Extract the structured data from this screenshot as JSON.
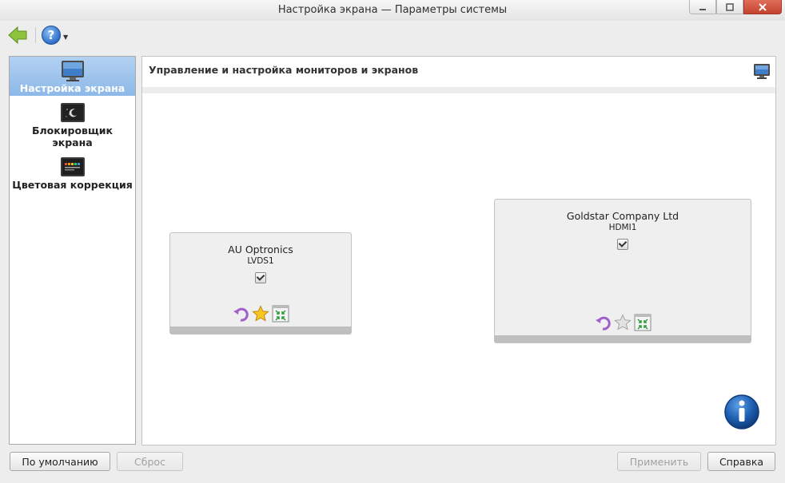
{
  "window": {
    "title": "Настройка экрана — Параметры системы",
    "controls": [
      "minimize",
      "maximize",
      "close"
    ]
  },
  "toolbar": {
    "back_icon": "back-arrow-icon",
    "help_icon": "help-icon"
  },
  "sidebar": {
    "items": [
      {
        "label": "Настройка экрана",
        "icon": "monitor-icon",
        "selected": true
      },
      {
        "label": "Блокировщик экрана",
        "icon": "screen-locker-icon",
        "selected": false
      },
      {
        "label": "Цветовая коррекция",
        "icon": "color-correction-icon",
        "selected": false
      }
    ]
  },
  "panel": {
    "header_title": "Управление и настройка мониторов и экранов",
    "header_icon": "monitor-icon"
  },
  "monitors": [
    {
      "name": "AU Optronics",
      "port": "LVDS1",
      "enabled": true,
      "primary": true
    },
    {
      "name": "Goldstar Company Ltd",
      "port": "HDMI1",
      "enabled": true,
      "primary": false
    }
  ],
  "buttons": {
    "defaults": "По умолчанию",
    "reset": "Сброс",
    "apply": "Применить",
    "help": "Справка"
  },
  "colors": {
    "sidebar_selected": "#9fc4ec",
    "info_icon": "#1d5fb0",
    "close_button": "#d0533e"
  }
}
